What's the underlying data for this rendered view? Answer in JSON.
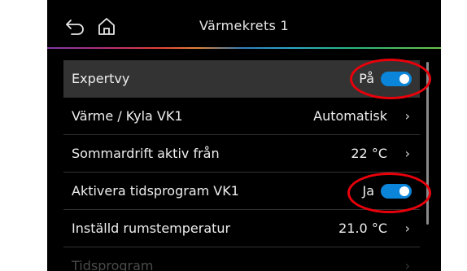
{
  "header": {
    "title": "Värmekrets 1",
    "back_icon": "back-arrow-icon",
    "home_icon": "home-icon"
  },
  "colors": {
    "background": "#000000",
    "highlight_row": "#333333",
    "toggle_on": "#0a85d9",
    "annotation": "#e8000b"
  },
  "rows": [
    {
      "label": "Expertvy",
      "value": "På",
      "type": "toggle",
      "on": true,
      "selected": true
    },
    {
      "label": "Värme / Kyla VK1",
      "value": "Automatisk",
      "type": "link"
    },
    {
      "label": "Sommardrift aktiv från",
      "value": "22 °C",
      "type": "link"
    },
    {
      "label": "Aktivera tidsprogram VK1",
      "value": "Ja",
      "type": "toggle",
      "on": true
    },
    {
      "label": "Inställd rumstemperatur",
      "value": "21.0 °C",
      "type": "link"
    },
    {
      "label": "Tidsprogram",
      "value": "",
      "type": "link",
      "disabled": true
    }
  ],
  "chevron": "›"
}
